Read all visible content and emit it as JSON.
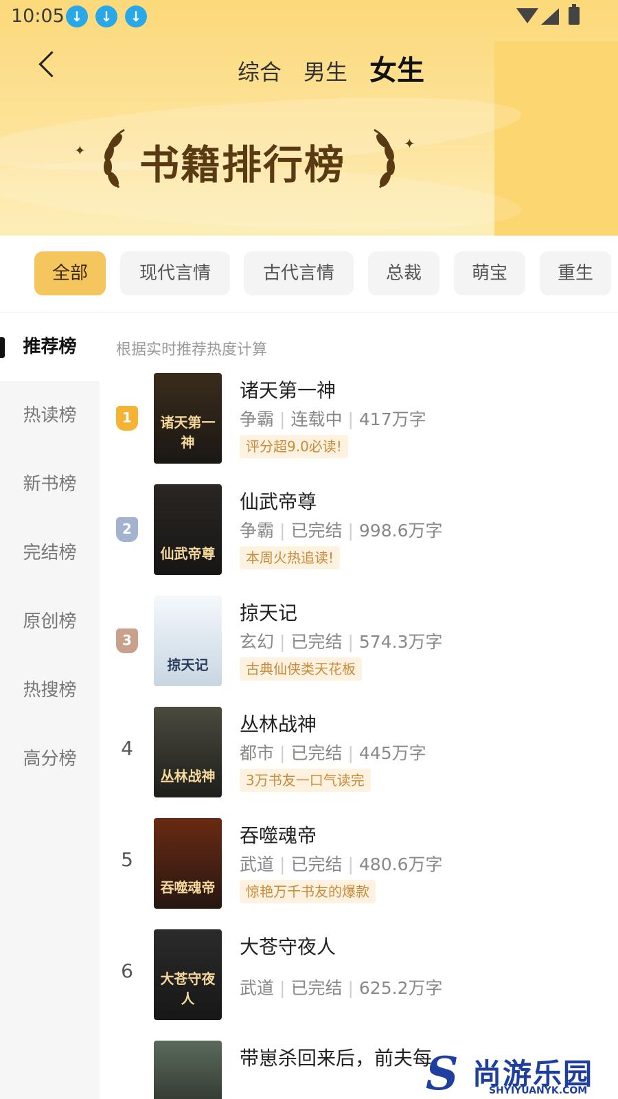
{
  "status_bar": {
    "time": "10:05",
    "download_icon_count": 3
  },
  "header": {
    "tabs": [
      {
        "label": "综合",
        "active": false
      },
      {
        "label": "男生",
        "active": false
      },
      {
        "label": "女生",
        "active": true
      }
    ],
    "banner_title": "书籍排行榜"
  },
  "categories": [
    {
      "label": "全部",
      "active": true
    },
    {
      "label": "现代言情",
      "active": false
    },
    {
      "label": "古代言情",
      "active": false
    },
    {
      "label": "总裁",
      "active": false
    },
    {
      "label": "萌宝",
      "active": false
    },
    {
      "label": "重生",
      "active": false
    }
  ],
  "sidebar": {
    "items": [
      {
        "label": "推荐榜",
        "active": true
      },
      {
        "label": "热读榜",
        "active": false
      },
      {
        "label": "新书榜",
        "active": false
      },
      {
        "label": "完结榜",
        "active": false
      },
      {
        "label": "原创榜",
        "active": false
      },
      {
        "label": "热搜榜",
        "active": false
      },
      {
        "label": "高分榜",
        "active": false
      }
    ]
  },
  "list": {
    "description": "根据实时推荐热度计算",
    "books": [
      {
        "rank": "1",
        "title": "诸天第一神",
        "genre": "争霸",
        "status": "连载中",
        "words": "417万字",
        "tag": "评分超9.0必读!",
        "cover_text": "诸天第一神",
        "badge_color": "#f5b233",
        "cover_color": "#3a2c1c"
      },
      {
        "rank": "2",
        "title": "仙武帝尊",
        "genre": "争霸",
        "status": "已完结",
        "words": "998.6万字",
        "tag": "本周火热追读!",
        "cover_text": "仙武帝尊",
        "badge_color": "#a3b3cf",
        "cover_color": "#2a2622"
      },
      {
        "rank": "3",
        "title": "掠天记",
        "genre": "玄幻",
        "status": "已完结",
        "words": "574.3万字",
        "tag": "古典仙侠类天花板",
        "cover_text": "掠天记",
        "badge_color": "#c9a08c",
        "cover_color": "#dfe8f0"
      },
      {
        "rank": "4",
        "title": "丛林战神",
        "genre": "都市",
        "status": "已完结",
        "words": "445万字",
        "tag": "3万书友一口气读完",
        "cover_text": "丛林战神",
        "badge_color": "",
        "cover_color": "#4a4a3e"
      },
      {
        "rank": "5",
        "title": "吞噬魂帝",
        "genre": "武道",
        "status": "已完结",
        "words": "480.6万字",
        "tag": "惊艳万千书友的爆款",
        "cover_text": "吞噬魂帝",
        "badge_color": "",
        "cover_color": "#6a2a12"
      },
      {
        "rank": "6",
        "title": "大苍守夜人",
        "genre": "武道",
        "status": "已完结",
        "words": "625.2万字",
        "tag": "",
        "cover_text": "大苍守夜人",
        "badge_color": "",
        "cover_color": "#2b2b2b"
      },
      {
        "rank": "",
        "title": "带崽杀回来后，前夫每",
        "genre": "",
        "status": "",
        "words": "",
        "tag": "",
        "cover_text": "",
        "badge_color": "",
        "cover_color": "#5a6a5a"
      }
    ]
  },
  "watermark": {
    "letter": "S",
    "name": "尚游乐园",
    "domain": "SHYIYUANYK.COM"
  }
}
